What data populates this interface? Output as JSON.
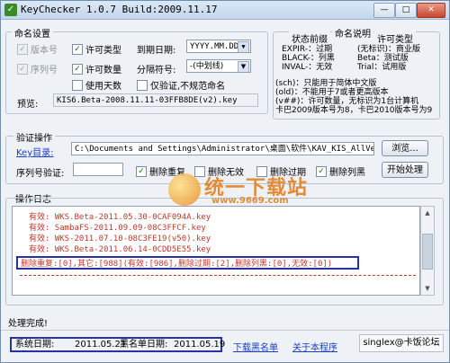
{
  "window": {
    "title": "KeyChecker 1.0.7 Build:2009.11.17",
    "minimize": "—",
    "maximize": "□",
    "close": "✕"
  },
  "naming": {
    "group_label": "命名设置",
    "cb_version": "版本号",
    "cb_serial": "序列号",
    "cb_license_type": "许可类型",
    "cb_license_count": "许可数量",
    "cb_use_days": "使用天数",
    "expiry_label": "到期日期:",
    "expiry_value": "YYYY.MM.DD",
    "separator_label": "分隔符号:",
    "separator_value": "-(中划线)",
    "cb_verify_only": "仅验证,不规范命名",
    "preview_label": "预览:",
    "preview_value": "KIS6.Beta-2008.11.11-03FFB8DE(v2).key"
  },
  "legend": {
    "status_header": "状态前缀",
    "naming_header": "命名说明",
    "license_header": "许可类型",
    "status_lines": [
      "EXPIR-：过期",
      "BLACK-：列黑",
      "INVAL-：无效"
    ],
    "license_lines": [
      "(无标识)：商业版",
      "Beta：测试版",
      "Trial：试用版"
    ],
    "notes": [
      "(sch)：只能用于简体中文版",
      "(old)：不能用于7或者更高版本",
      "(v##)：许可数量，无标识为1台计算机",
      "卡巴2009版本号为8，卡巴2010版本号为9"
    ]
  },
  "verify": {
    "group_label": "验证操作",
    "key_dir_label": "Key目录:",
    "key_dir_value": "C:\\Documents and Settings\\Administrator\\桌面\\软件\\KAV_KIS_AllVerKey\\",
    "browse_button": "浏览...",
    "serial_label": "序列号验证:",
    "serial_value": "",
    "cb_remove_dup": "删除重复",
    "cb_remove_invalid": "删除无效",
    "cb_remove_expired": "删除过期",
    "cb_remove_black": "删除列黑",
    "start_button": "开始处理"
  },
  "log": {
    "group_label": "操作日志",
    "lines": [
      "有效: WKS.Beta-2011.05.30-0CAF094A.key",
      "有效: SambaFS-2011.09.09-08C3FFCF.key",
      "有效: WKS-2011.07.10-08C3FE19(v50).key",
      "有效: WKS.Beta-2011.06.14-0CDD5E55.key"
    ],
    "summary": "删除重复:[0],其它:[988](有效:[986],删除过期:[2],删除列黑:[0],无效:[0])",
    "scroll_up": "▲",
    "scroll_down": "▼"
  },
  "status": {
    "done": "处理完成!",
    "sys_date_label": "系统日期:",
    "sys_date_value": "2011.05.21",
    "black_date_label": "黑名单日期:",
    "black_date_value": "2011.05.19",
    "download_blacklist": "下载黑名单",
    "about": "关于本程序",
    "author": "singlex@卡饭论坛"
  },
  "watermark": {
    "text": "统一下载站",
    "url": "www.9669.com"
  },
  "colors": {
    "accent_blue": "#2633a6",
    "log_red": "#c0392b",
    "link": "#1a3dc8"
  }
}
